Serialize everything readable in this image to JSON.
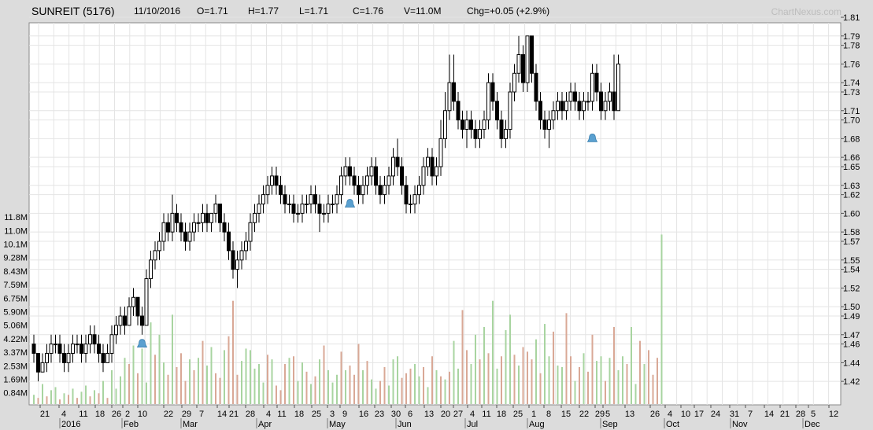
{
  "header": {
    "symbol": "SUNREIT (5176)",
    "date": "11/10/2016",
    "open": "O=1.71",
    "high": "H=1.77",
    "low": "L=1.71",
    "close": "C=1.76",
    "volume": "V=11.0M",
    "change": "Chg=+0.05 (+2.9%)"
  },
  "watermark": "ChartNexus.com",
  "colors": {
    "up_candle": "#ffffff",
    "down_candle": "#000000",
    "volume_up": "#a8d4a0",
    "volume_down": "#d9a896",
    "alert_icon": "#5aa0d0",
    "grid": "#e4e4e4"
  },
  "chart_data": {
    "type": "candlestick",
    "title": "SUNREIT (5176)",
    "price_axis": {
      "ticks": [
        "1.42",
        "1.44",
        "1.46",
        "1.47",
        "1.49",
        "1.50",
        "1.52",
        "1.54",
        "1.55",
        "1.57",
        "1.58",
        "1.60",
        "1.62",
        "1.63",
        "1.65",
        "1.66",
        "1.68",
        "1.70",
        "1.71",
        "1.73",
        "1.74",
        "1.76",
        "1.78",
        "1.79",
        "1.81"
      ],
      "range": [
        1.41,
        1.81
      ]
    },
    "volume_axis": {
      "ticks": [
        "0.84M",
        "1.69M",
        "2.53M",
        "3.37M",
        "4.22M",
        "5.06M",
        "5.90M",
        "6.75M",
        "7.59M",
        "8.43M",
        "9.28M",
        "10.1M",
        "11.0M",
        "11.8M"
      ],
      "range": [
        0,
        12.65
      ]
    },
    "x_axis": {
      "day_labels": [
        "21",
        "4",
        "11",
        "18",
        "26",
        "2",
        "10",
        "22",
        "29",
        "7",
        "14",
        "21",
        "28",
        "4",
        "11",
        "18",
        "25",
        "3",
        "9",
        "16",
        "23",
        "30",
        "6",
        "13",
        "20",
        "27",
        "4",
        "11",
        "18",
        "25",
        "1",
        "8",
        "15",
        "22",
        "29",
        "5",
        "13",
        "26",
        "4",
        "10",
        "17",
        "24",
        "31",
        "7",
        "14",
        "21",
        "28",
        "5",
        "12"
      ],
      "month_labels": [
        "2016",
        "Feb",
        "Mar",
        "Apr",
        "May",
        "Jun",
        "Jul",
        "Aug",
        "Sep",
        "Oct",
        "Nov",
        "Dec"
      ]
    },
    "alerts": [
      {
        "price": 1.46,
        "position": "Feb 10"
      },
      {
        "price": 1.61,
        "position": "May 10"
      },
      {
        "price": 1.68,
        "position": "Aug 24"
      }
    ],
    "ohlc": [
      [
        1.46,
        1.47,
        1.44,
        1.45
      ],
      [
        1.45,
        1.45,
        1.42,
        1.43
      ],
      [
        1.43,
        1.45,
        1.43,
        1.44
      ],
      [
        1.44,
        1.46,
        1.43,
        1.45
      ],
      [
        1.45,
        1.47,
        1.44,
        1.46
      ],
      [
        1.46,
        1.47,
        1.45,
        1.46
      ],
      [
        1.46,
        1.47,
        1.44,
        1.45
      ],
      [
        1.45,
        1.46,
        1.43,
        1.44
      ],
      [
        1.44,
        1.46,
        1.43,
        1.45
      ],
      [
        1.45,
        1.47,
        1.44,
        1.46
      ],
      [
        1.46,
        1.47,
        1.45,
        1.46
      ],
      [
        1.46,
        1.47,
        1.44,
        1.45
      ],
      [
        1.45,
        1.47,
        1.44,
        1.46
      ],
      [
        1.46,
        1.48,
        1.45,
        1.47
      ],
      [
        1.47,
        1.48,
        1.45,
        1.46
      ],
      [
        1.46,
        1.47,
        1.44,
        1.45
      ],
      [
        1.45,
        1.46,
        1.43,
        1.44
      ],
      [
        1.44,
        1.46,
        1.44,
        1.45
      ],
      [
        1.45,
        1.48,
        1.44,
        1.47
      ],
      [
        1.47,
        1.49,
        1.46,
        1.48
      ],
      [
        1.48,
        1.5,
        1.47,
        1.49
      ],
      [
        1.49,
        1.5,
        1.47,
        1.48
      ],
      [
        1.48,
        1.51,
        1.48,
        1.5
      ],
      [
        1.5,
        1.52,
        1.49,
        1.51
      ],
      [
        1.51,
        1.51,
        1.48,
        1.49
      ],
      [
        1.49,
        1.5,
        1.47,
        1.48
      ],
      [
        1.48,
        1.54,
        1.48,
        1.53
      ],
      [
        1.53,
        1.56,
        1.52,
        1.55
      ],
      [
        1.55,
        1.57,
        1.54,
        1.56
      ],
      [
        1.56,
        1.58,
        1.55,
        1.57
      ],
      [
        1.57,
        1.6,
        1.56,
        1.59
      ],
      [
        1.59,
        1.6,
        1.57,
        1.58
      ],
      [
        1.58,
        1.62,
        1.57,
        1.6
      ],
      [
        1.6,
        1.61,
        1.58,
        1.59
      ],
      [
        1.59,
        1.6,
        1.57,
        1.58
      ],
      [
        1.58,
        1.59,
        1.56,
        1.57
      ],
      [
        1.57,
        1.59,
        1.56,
        1.58
      ],
      [
        1.58,
        1.6,
        1.57,
        1.59
      ],
      [
        1.59,
        1.6,
        1.58,
        1.59
      ],
      [
        1.59,
        1.61,
        1.58,
        1.6
      ],
      [
        1.6,
        1.61,
        1.58,
        1.59
      ],
      [
        1.59,
        1.6,
        1.58,
        1.6
      ],
      [
        1.6,
        1.62,
        1.59,
        1.61
      ],
      [
        1.61,
        1.61,
        1.58,
        1.59
      ],
      [
        1.59,
        1.6,
        1.57,
        1.58
      ],
      [
        1.58,
        1.59,
        1.55,
        1.56
      ],
      [
        1.56,
        1.57,
        1.53,
        1.54
      ],
      [
        1.54,
        1.56,
        1.52,
        1.55
      ],
      [
        1.55,
        1.57,
        1.54,
        1.56
      ],
      [
        1.56,
        1.58,
        1.55,
        1.57
      ],
      [
        1.57,
        1.6,
        1.56,
        1.59
      ],
      [
        1.59,
        1.61,
        1.58,
        1.6
      ],
      [
        1.6,
        1.62,
        1.59,
        1.61
      ],
      [
        1.61,
        1.63,
        1.6,
        1.62
      ],
      [
        1.62,
        1.64,
        1.61,
        1.63
      ],
      [
        1.63,
        1.65,
        1.62,
        1.64
      ],
      [
        1.64,
        1.65,
        1.62,
        1.63
      ],
      [
        1.63,
        1.64,
        1.61,
        1.62
      ],
      [
        1.62,
        1.63,
        1.6,
        1.61
      ],
      [
        1.61,
        1.62,
        1.6,
        1.61
      ],
      [
        1.61,
        1.62,
        1.59,
        1.6
      ],
      [
        1.6,
        1.61,
        1.59,
        1.6
      ],
      [
        1.6,
        1.62,
        1.59,
        1.61
      ],
      [
        1.61,
        1.62,
        1.6,
        1.61
      ],
      [
        1.61,
        1.63,
        1.6,
        1.62
      ],
      [
        1.62,
        1.63,
        1.6,
        1.61
      ],
      [
        1.61,
        1.62,
        1.58,
        1.6
      ],
      [
        1.6,
        1.61,
        1.59,
        1.6
      ],
      [
        1.6,
        1.62,
        1.59,
        1.61
      ],
      [
        1.61,
        1.62,
        1.6,
        1.61
      ],
      [
        1.61,
        1.63,
        1.6,
        1.62
      ],
      [
        1.62,
        1.65,
        1.61,
        1.64
      ],
      [
        1.64,
        1.66,
        1.63,
        1.65
      ],
      [
        1.65,
        1.66,
        1.63,
        1.64
      ],
      [
        1.64,
        1.65,
        1.62,
        1.63
      ],
      [
        1.63,
        1.64,
        1.61,
        1.62
      ],
      [
        1.62,
        1.64,
        1.61,
        1.63
      ],
      [
        1.63,
        1.65,
        1.62,
        1.64
      ],
      [
        1.64,
        1.66,
        1.63,
        1.65
      ],
      [
        1.65,
        1.66,
        1.62,
        1.63
      ],
      [
        1.63,
        1.64,
        1.61,
        1.62
      ],
      [
        1.62,
        1.64,
        1.61,
        1.63
      ],
      [
        1.63,
        1.65,
        1.62,
        1.64
      ],
      [
        1.64,
        1.67,
        1.63,
        1.66
      ],
      [
        1.66,
        1.68,
        1.64,
        1.65
      ],
      [
        1.65,
        1.66,
        1.62,
        1.63
      ],
      [
        1.63,
        1.64,
        1.6,
        1.61
      ],
      [
        1.61,
        1.62,
        1.6,
        1.61
      ],
      [
        1.61,
        1.63,
        1.6,
        1.62
      ],
      [
        1.62,
        1.64,
        1.61,
        1.63
      ],
      [
        1.63,
        1.66,
        1.62,
        1.65
      ],
      [
        1.65,
        1.67,
        1.64,
        1.66
      ],
      [
        1.66,
        1.67,
        1.63,
        1.64
      ],
      [
        1.64,
        1.66,
        1.63,
        1.65
      ],
      [
        1.65,
        1.7,
        1.64,
        1.68
      ],
      [
        1.68,
        1.73,
        1.67,
        1.71
      ],
      [
        1.71,
        1.77,
        1.7,
        1.74
      ],
      [
        1.74,
        1.77,
        1.71,
        1.72
      ],
      [
        1.72,
        1.73,
        1.69,
        1.7
      ],
      [
        1.7,
        1.71,
        1.68,
        1.69
      ],
      [
        1.69,
        1.71,
        1.67,
        1.7
      ],
      [
        1.7,
        1.71,
        1.68,
        1.69
      ],
      [
        1.69,
        1.7,
        1.67,
        1.68
      ],
      [
        1.68,
        1.7,
        1.67,
        1.69
      ],
      [
        1.69,
        1.71,
        1.68,
        1.7
      ],
      [
        1.7,
        1.75,
        1.69,
        1.74
      ],
      [
        1.74,
        1.75,
        1.71,
        1.72
      ],
      [
        1.72,
        1.73,
        1.69,
        1.7
      ],
      [
        1.7,
        1.71,
        1.67,
        1.68
      ],
      [
        1.68,
        1.7,
        1.67,
        1.69
      ],
      [
        1.69,
        1.74,
        1.68,
        1.73
      ],
      [
        1.73,
        1.76,
        1.72,
        1.75
      ],
      [
        1.75,
        1.79,
        1.74,
        1.77
      ],
      [
        1.77,
        1.78,
        1.73,
        1.74
      ],
      [
        1.74,
        1.79,
        1.73,
        1.79
      ],
      [
        1.79,
        1.79,
        1.74,
        1.75
      ],
      [
        1.75,
        1.76,
        1.71,
        1.72
      ],
      [
        1.72,
        1.73,
        1.69,
        1.7
      ],
      [
        1.7,
        1.71,
        1.68,
        1.69
      ],
      [
        1.69,
        1.71,
        1.67,
        1.7
      ],
      [
        1.7,
        1.72,
        1.69,
        1.71
      ],
      [
        1.71,
        1.73,
        1.7,
        1.72
      ],
      [
        1.72,
        1.73,
        1.7,
        1.71
      ],
      [
        1.71,
        1.73,
        1.7,
        1.72
      ],
      [
        1.72,
        1.74,
        1.71,
        1.73
      ],
      [
        1.73,
        1.74,
        1.71,
        1.72
      ],
      [
        1.72,
        1.73,
        1.7,
        1.71
      ],
      [
        1.71,
        1.73,
        1.7,
        1.72
      ],
      [
        1.72,
        1.73,
        1.71,
        1.72
      ],
      [
        1.72,
        1.76,
        1.71,
        1.75
      ],
      [
        1.75,
        1.76,
        1.72,
        1.73
      ],
      [
        1.73,
        1.74,
        1.7,
        1.71
      ],
      [
        1.71,
        1.73,
        1.7,
        1.72
      ],
      [
        1.72,
        1.74,
        1.71,
        1.73
      ],
      [
        1.73,
        1.77,
        1.7,
        1.71
      ],
      [
        1.71,
        1.77,
        1.71,
        1.76
      ]
    ],
    "volume_m": [
      0.6,
      0.4,
      1.3,
      0.5,
      0.9,
      1.1,
      0.3,
      0.7,
      0.6,
      1.0,
      0.4,
      0.8,
      1.2,
      0.5,
      0.9,
      0.7,
      1.5,
      0.4,
      2.2,
      1.0,
      1.8,
      3.0,
      2.6,
      3.8,
      2.0,
      3.6,
      1.4,
      5.3,
      3.2,
      4.5,
      2.7,
      1.9,
      5.8,
      2.4,
      3.3,
      1.5,
      2.9,
      2.2,
      3.0,
      4.1,
      2.5,
      3.7,
      2.0,
      1.7,
      3.5,
      4.4,
      6.7,
      1.9,
      2.8,
      3.6,
      3.5,
      2.3,
      2.6,
      1.4,
      3.2,
      2.9,
      1.2,
      0.9,
      2.6,
      3.0,
      3.1,
      1.5,
      2.7,
      2.1,
      1.3,
      1.8,
      2.9,
      3.8,
      2.2,
      1.4,
      1.9,
      3.4,
      2.2,
      2.5,
      1.9,
      3.9,
      2.2,
      2.8,
      1.6,
      1.0,
      1.5,
      2.4,
      1.2,
      2.9,
      3.1,
      1.7,
      2.0,
      2.3,
      2.6,
      1.8,
      2.4,
      1.1,
      3.1,
      2.2,
      1.8,
      1.6,
      2.1,
      4.1,
      2.3,
      6.1,
      3.5,
      2.6,
      4.5,
      2.9,
      5.0,
      3.3,
      6.7,
      2.3,
      3.1,
      4.8,
      5.8,
      3.2,
      2.5,
      3.7,
      3.4,
      2.9,
      4.2,
      2.0,
      5.2,
      3.1,
      4.7,
      2.5,
      2.4,
      5.9,
      3.1,
      1.5,
      2.4,
      3.3,
      2.1,
      4.5,
      2.8,
      3.1,
      1.5,
      3.0,
      5.0,
      2.2,
      3.1,
      2.6,
      5.0,
      1.3,
      4.1,
      2.6,
      3.5,
      1.9,
      3.0,
      11.0
    ],
    "volume_up_flags": [
      1,
      0,
      1,
      0,
      1,
      1,
      0,
      1,
      0,
      1,
      0,
      1,
      1,
      0,
      1,
      0,
      1,
      0,
      1,
      1,
      1,
      1,
      0,
      1,
      0,
      1,
      1,
      1,
      0,
      1,
      1,
      0,
      1,
      0,
      0,
      0,
      1,
      0,
      1,
      0,
      1,
      1,
      0,
      0,
      1,
      0,
      0,
      0,
      1,
      1,
      1,
      1,
      1,
      1,
      0,
      1,
      0,
      0,
      0,
      1,
      0,
      1,
      1,
      0,
      1,
      0,
      1,
      0,
      1,
      1,
      1,
      0,
      1,
      0,
      0,
      0,
      1,
      0,
      1,
      1,
      0,
      0,
      1,
      1,
      1,
      0,
      0,
      0,
      1,
      1,
      0,
      1,
      0,
      1,
      0,
      1,
      0,
      1,
      1,
      0,
      0,
      1,
      1,
      0,
      1,
      0,
      1,
      1,
      0,
      1,
      1,
      0,
      1,
      0,
      0,
      0,
      1,
      0,
      1,
      1,
      0,
      1,
      1,
      0,
      0,
      1,
      0,
      1,
      0,
      0,
      1,
      1,
      0,
      1,
      0,
      1,
      1,
      0,
      1,
      1,
      0,
      1,
      0,
      0,
      0,
      1
    ]
  }
}
